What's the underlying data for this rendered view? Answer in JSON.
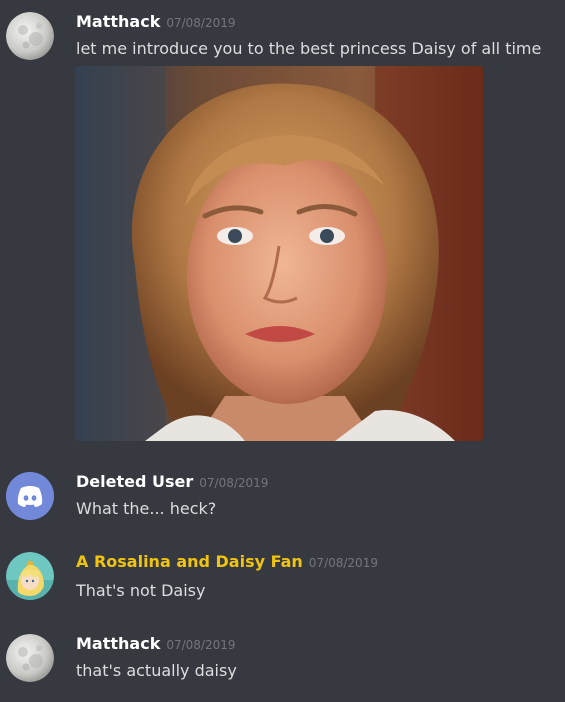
{
  "messages": [
    {
      "author": "Matthack",
      "timestamp": "07/08/2019",
      "text": "let me introduce you to the best princess Daisy of all time",
      "author_color": "#ffffff"
    },
    {
      "author": "Deleted User",
      "timestamp": "07/08/2019",
      "text": "What the... heck?",
      "author_color": "#ffffff"
    },
    {
      "author": "A Rosalina and Daisy Fan",
      "timestamp": "07/08/2019",
      "text": "That's not Daisy",
      "author_color": "#f1c40f"
    },
    {
      "author": "Matthack",
      "timestamp": "07/08/2019",
      "text": "that's actually daisy",
      "author_color": "#ffffff"
    }
  ],
  "icons": {
    "moon_avatar": "moon-avatar-icon",
    "discord_avatar": "discord-logo-icon",
    "rosalina_avatar": "rosalina-avatar-icon"
  },
  "colors": {
    "background": "#36393f",
    "username": "#ffffff",
    "username_highlight": "#f1c40f",
    "timestamp": "#72767d",
    "message_text": "#dcddde",
    "discord_blurple": "#7289da"
  }
}
